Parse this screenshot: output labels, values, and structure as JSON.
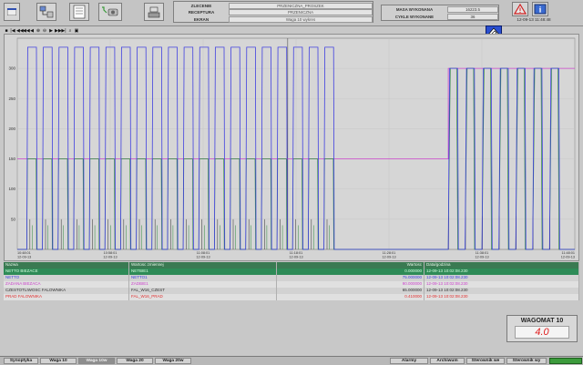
{
  "info": {
    "order_label": "ZLECENIE",
    "order_value": "PRZENICZNA_PROSZEK",
    "recipe_label": "RECEPTURA",
    "recipe_value": "PRZENICZNA",
    "screen_label": "EKRAN",
    "screen_value": "Waga 10 wykres"
  },
  "mass": {
    "done_label": "MASA WYKONANA",
    "done_value": "16223.5",
    "cycles_label": "CYKLE WYKONANE",
    "cycles_value": "36"
  },
  "datetime": "12-09-13 11:48:48",
  "chart_toolbar": [
    "■",
    "|◀",
    "◀◀",
    "◀◀",
    "◀",
    "⊕",
    "⊖",
    "▶",
    "▶▶",
    "▶|",
    "⌕",
    "▣"
  ],
  "pen_button": {
    "label": "2"
  },
  "chart_data": {
    "type": "line",
    "ylim": [
      0,
      350
    ],
    "y_ticks": [
      "300",
      "250",
      "200",
      "150",
      "100",
      "50"
    ],
    "x_ticks": [
      {
        "time": "10:48:01",
        "date": "12-09-13"
      },
      {
        "time": "10:58:01",
        "date": "12-09-13"
      },
      {
        "time": "11:08:01",
        "date": "12-09-13"
      },
      {
        "time": "11:18:01",
        "date": "12-09-13"
      },
      {
        "time": "11:28:01",
        "date": "12-09-13"
      },
      {
        "time": "11:38:01",
        "date": "12-09-13"
      },
      {
        "time": "11:48:01",
        "date": "12-09-13"
      }
    ],
    "series": [
      {
        "name": "NETTO BIEZACE",
        "color": "#2e8b3e"
      },
      {
        "name": "NETTO",
        "color": "#4040e0"
      },
      {
        "name": "ZADANA BIEZACA",
        "color": "#cc44cc"
      },
      {
        "name": "CZESTOTLIWOSC FALOWNIKA",
        "color": "#303030"
      },
      {
        "name": "PRAD FALOWNIKA",
        "color": "#e03030"
      }
    ],
    "cycle1": {
      "count": 20,
      "peak": 335,
      "plateau": 150
    },
    "cycle2": {
      "count": 7,
      "peak": 300,
      "plateau": 300
    },
    "setpoint_phase1": 150,
    "setpoint_phase2": 300
  },
  "table": {
    "headers": [
      "Nazwa",
      "Wartosc zmiennej",
      "Wartosc",
      "Data/godzina"
    ],
    "rows": [
      {
        "name": "NETTO BIEZACE",
        "var": "NETBIE1",
        "value": "0.000000",
        "time": "12-09-13 10:02:08.230",
        "color": "#2e8b3e"
      },
      {
        "name": "NETTO",
        "var": "NETTO1",
        "value": "75.000000",
        "time": "12-09-13 10:02:08.230",
        "color": "#4040e0"
      },
      {
        "name": "ZADANA BIEZACA",
        "var": "ZADBIE1",
        "value": "90.000000",
        "time": "12-09-13 10:02:08.230",
        "color": "#cc44cc"
      },
      {
        "name": "CZESTOTLIWOSC FALOWNIKA",
        "var": "FAL_W16_CZEST",
        "value": "65.000000",
        "time": "12-09-13 10:02:08.230",
        "color": "#303030"
      },
      {
        "name": "PRAD FALOWNIKA",
        "var": "FAL_W16_PRAD",
        "value": "0.410000",
        "time": "12-09-13 10:02:08.230",
        "color": "#e03030"
      }
    ]
  },
  "wagomat": {
    "title": "WAGOMAT 10",
    "value": "4.0"
  },
  "tabs": [
    "Synoptyka",
    "Waga 10",
    "Waga 10w",
    "Waga 20",
    "Waga 20w",
    "Alarmy",
    "Archiwum",
    "Sterownik we",
    "Sterownik wy"
  ]
}
